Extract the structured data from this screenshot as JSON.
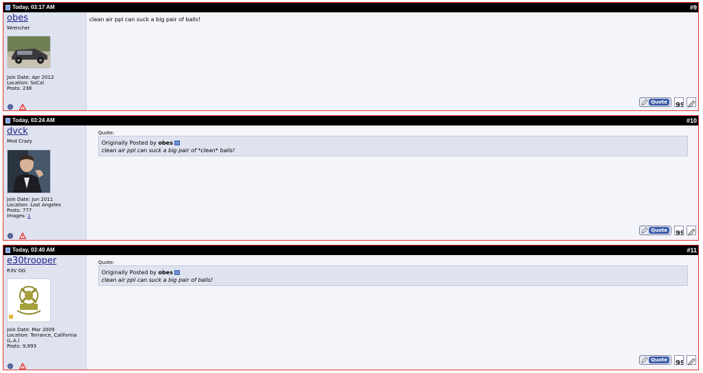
{
  "posts": [
    {
      "date": "Today, 03:17 AM",
      "number": "#9",
      "username": "obes",
      "user_title": "Wrencher",
      "avatar_icon": "car-photo-avatar",
      "join_date": "Join Date: Apr 2012",
      "location": "Location: SoCal",
      "posts": "Posts: 238",
      "message": "clean air ppl can suck a big pair of balls!"
    },
    {
      "date": "Today, 03:24 AM",
      "number": "#10",
      "username": "dvck",
      "user_title": "Mod Crazy",
      "avatar_icon": "person-photo-avatar",
      "join_date": "Join Date: Jun 2011",
      "location": "Location: Lost Angeles",
      "posts": "Posts: 777",
      "images_label": "Images:",
      "images_count": "1",
      "quote_label": "Quote:",
      "quote_by": "Originally Posted by",
      "quote_author": "obes",
      "quote_text": "clean air ppl can suck a big pair of *clean* balls!"
    },
    {
      "date": "Today, 03:40 AM",
      "number": "#11",
      "username": "e30trooper",
      "user_title": "R3V OG",
      "avatar_icon": "mascot-logo-avatar",
      "join_date": "Join Date: Mar 2009",
      "location": "Location: Torrance, California",
      "location_cont": "(L.A.)",
      "posts": "Posts: 9,993",
      "quote_label": "Quote:",
      "quote_by": "Originally Posted by",
      "quote_author": "obes",
      "quote_text": "clean air ppl can suck a big pair of balls!"
    }
  ],
  "buttons": {
    "quote": "Quote"
  },
  "colors": {
    "header_bg": "#000000",
    "post_border": "#e0342f",
    "sidebar_bg": "#dfe3ef",
    "link": "#22228a",
    "quote_btn": "#3c5ca9"
  }
}
